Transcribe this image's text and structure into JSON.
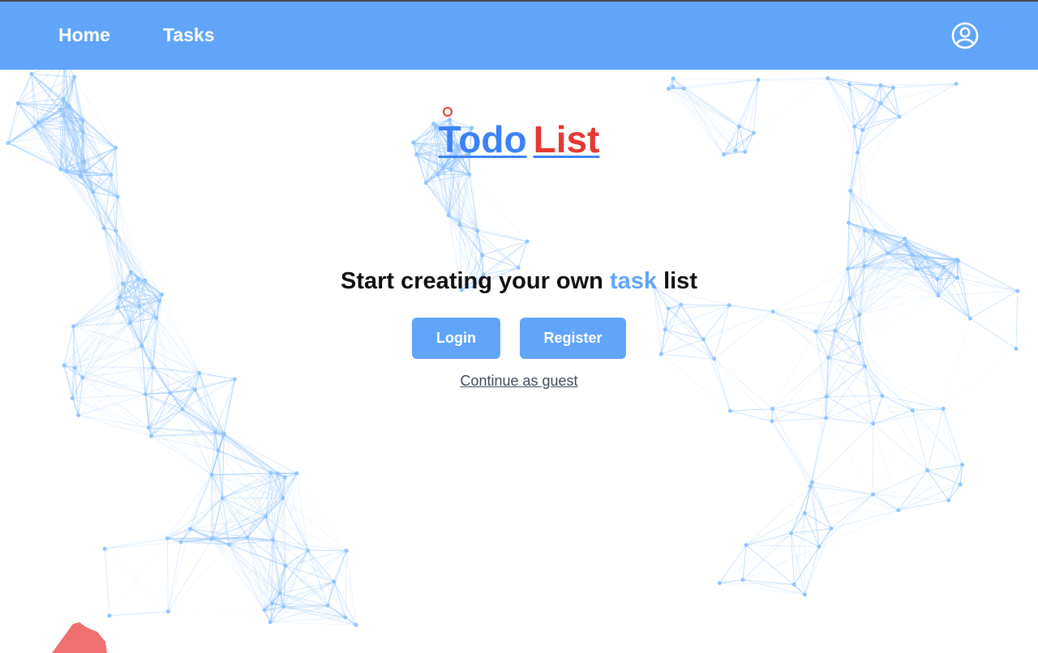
{
  "nav": {
    "links": [
      {
        "label": "Home"
      },
      {
        "label": "Tasks"
      }
    ],
    "account_icon": "user-circle-icon"
  },
  "logo": {
    "word1": "Todo",
    "word2": "List"
  },
  "hero": {
    "tagline_before": "Start creating your own ",
    "tagline_accent": "task",
    "tagline_after": " list",
    "login_label": "Login",
    "register_label": "Register",
    "guest_label": "Continue as guest"
  },
  "colors": {
    "nav_bg": "#60a5fa",
    "button_bg": "#60a5fa",
    "logo_blue": "#3b82f6",
    "logo_red": "#e53935",
    "network": "#93c5fd"
  }
}
